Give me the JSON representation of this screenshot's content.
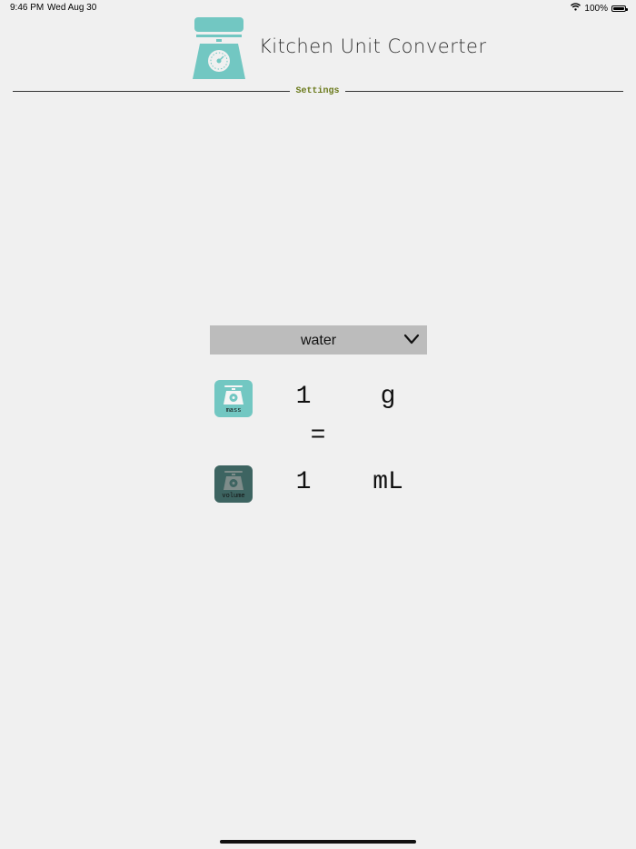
{
  "status_bar": {
    "time": "9:46 PM",
    "date": "Wed Aug 30",
    "battery": "100%",
    "battery_level": 1.0
  },
  "header": {
    "title": "Kitchen Unit Converter",
    "logo_icon": "kitchen-scale-icon",
    "logo_color": "#72c7c2"
  },
  "settings": {
    "label": "Settings",
    "color": "#6b7a1c"
  },
  "ingredient": {
    "selected": "water",
    "icon": "chevron-down-icon"
  },
  "conversion": {
    "mass": {
      "icon": "mass-scale-icon",
      "icon_label": "mass",
      "amount": "1",
      "unit": "g",
      "color": "#72c7c2"
    },
    "equals": "=",
    "volume": {
      "icon": "volume-scale-icon",
      "icon_label": "volume",
      "amount": "1",
      "unit": "mL",
      "color": "#3d6461"
    }
  }
}
